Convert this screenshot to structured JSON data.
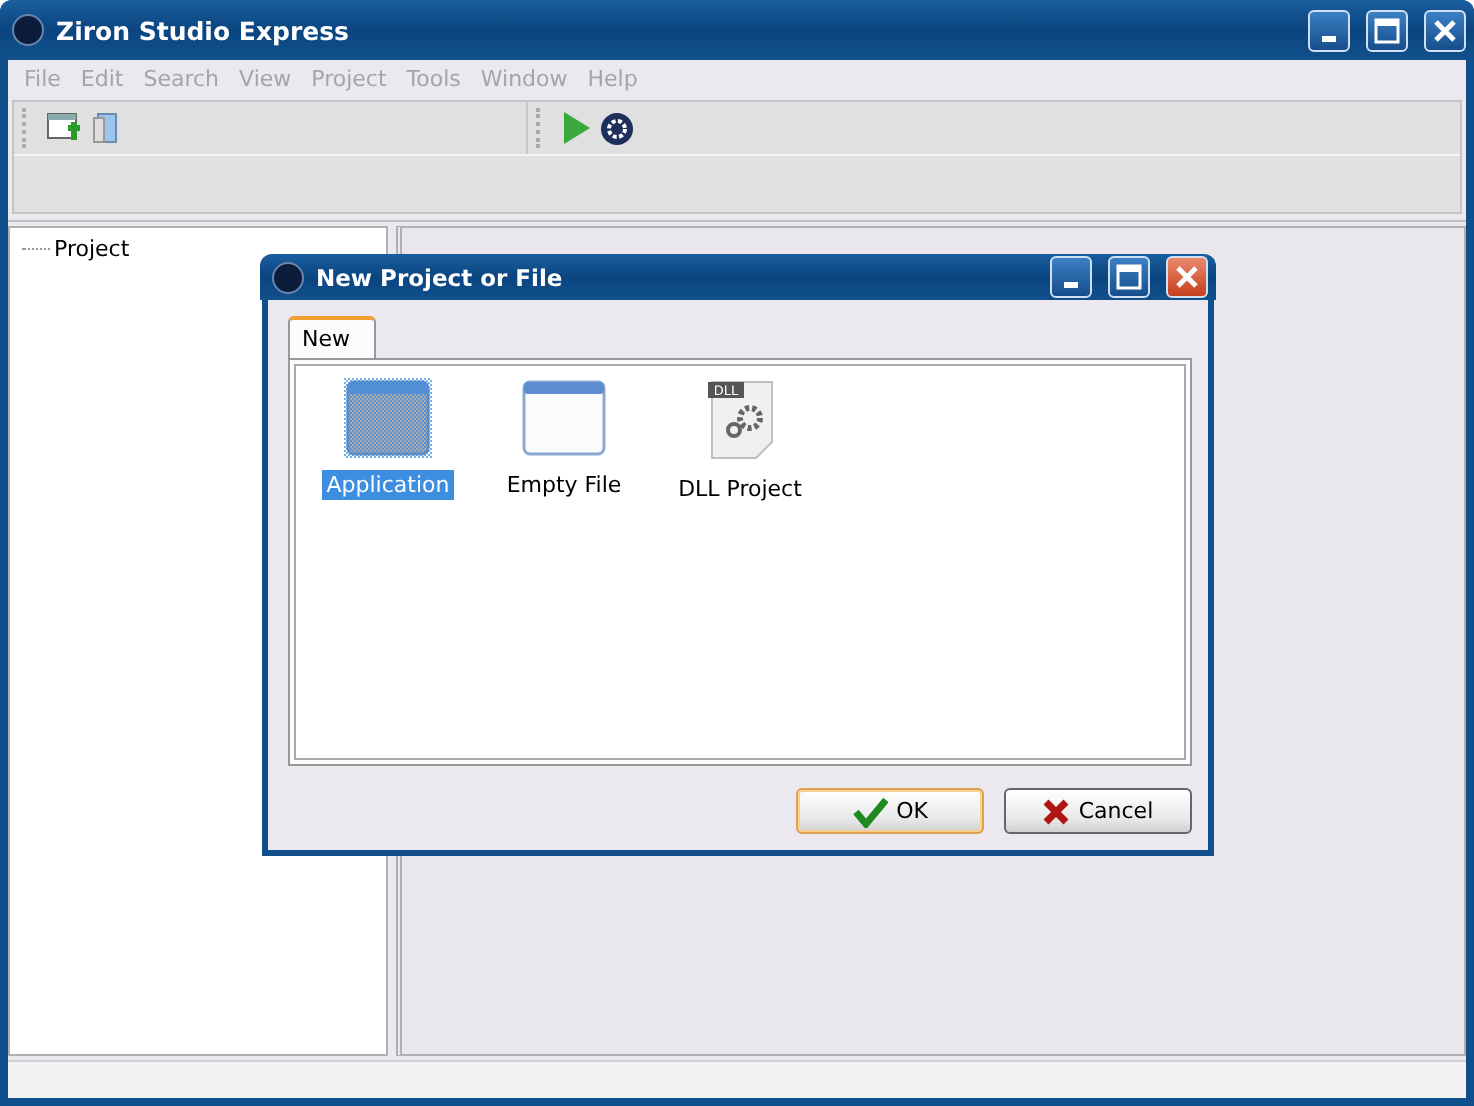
{
  "window": {
    "title": "Ziron Studio Express"
  },
  "menu": [
    {
      "label": "File",
      "disabled": true
    },
    {
      "label": "Edit",
      "disabled": true
    },
    {
      "label": "Search",
      "disabled": true
    },
    {
      "label": "View",
      "disabled": true
    },
    {
      "label": "Project",
      "disabled": true
    },
    {
      "label": "Tools",
      "disabled": true
    },
    {
      "label": "Window",
      "disabled": true
    },
    {
      "label": "Help",
      "disabled": true
    }
  ],
  "project_tree": {
    "items": [
      {
        "label": "Project"
      }
    ]
  },
  "dialog": {
    "title": "New Project or File",
    "tabs": [
      {
        "label": "New",
        "selected": true
      }
    ],
    "items": [
      {
        "label": "Application",
        "kind": "application",
        "selected": true
      },
      {
        "label": "Empty File",
        "kind": "file",
        "selected": false
      },
      {
        "label": "DLL Project",
        "kind": "dll",
        "badge": "DLL",
        "selected": false
      }
    ],
    "buttons": [
      {
        "label": "OK",
        "kind": "ok",
        "focused": true
      },
      {
        "label": "Cancel",
        "kind": "cancel",
        "focused": false
      }
    ]
  }
}
